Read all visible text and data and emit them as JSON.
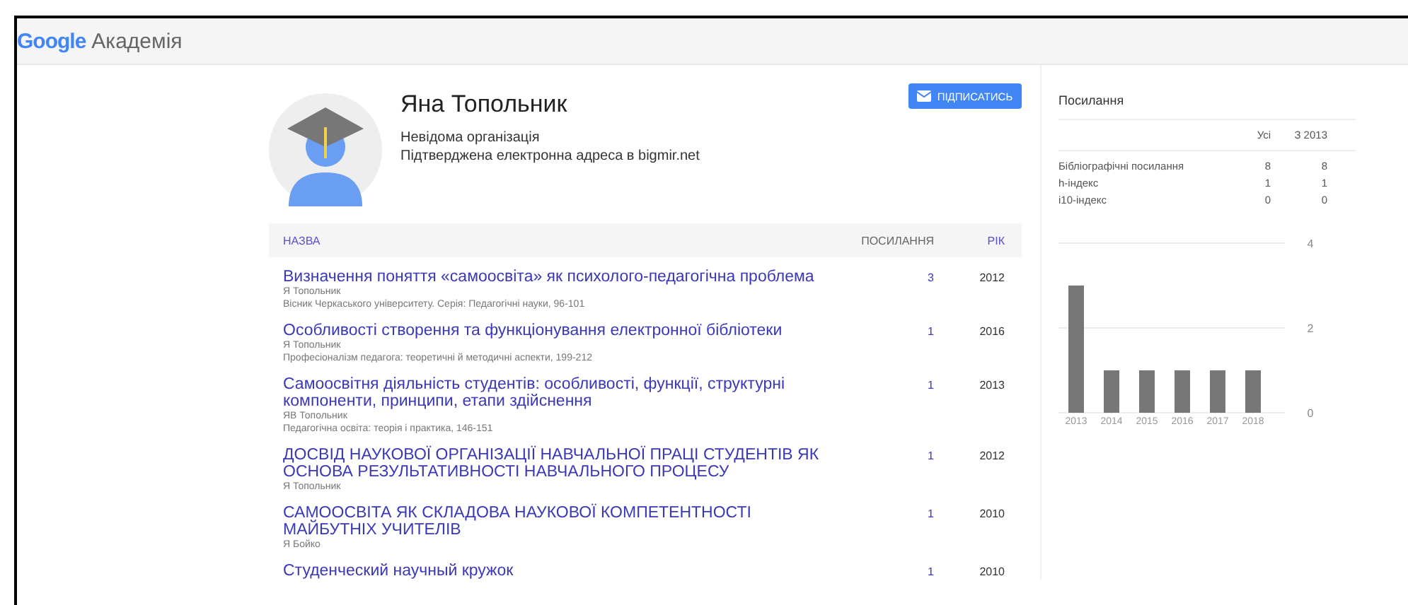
{
  "header": {
    "logo": "Google",
    "product": "Академія"
  },
  "profile": {
    "name": "Яна Топольник",
    "affiliation": "Невідома організація",
    "email": "Підтверджена електронна адреса в bigmir.net",
    "follow_button": "ПІДПИСАТИСЬ"
  },
  "table": {
    "columns": [
      "НАЗВА",
      "ПОСИЛАННЯ",
      "РІК"
    ],
    "rows": [
      {
        "title": "Визначення поняття «самоосвіта» як психолого-педагогічна проблема",
        "authors": "Я Топольник",
        "source": "Вісник Черкаського університету. Серія: Педагогічні науки, 96-101",
        "citations": "3",
        "year": "2012"
      },
      {
        "title": "Особливості створення та функціонування електронної бібліотеки",
        "authors": "Я Топольник",
        "source": "Професіоналізм педагога: теоретичні й методичні аспекти, 199-212",
        "citations": "1",
        "year": "2016"
      },
      {
        "title": "Самоосвітня діяльність студентів: особливості, функції, структурні компоненти, принципи, етапи здійснення",
        "authors": "ЯВ Топольник",
        "source": "Педагогічна освіта: теорія і практика, 146-151",
        "citations": "1",
        "year": "2013"
      },
      {
        "title": "ДОСВІД НАУКОВОЇ ОРГАНІЗАЦІЇ НАВЧАЛЬНОЇ ПРАЦІ СТУДЕНТІВ ЯК ОСНОВА РЕЗУЛЬТАТИВНОСТІ НАВЧАЛЬНОГО ПРОЦЕСУ",
        "authors": "Я Топольник",
        "citations": "1",
        "year": "2012"
      },
      {
        "title": "САМООСВІТА ЯК СКЛАДОВА НАУКОВОЇ КОМПЕТЕНТНОСТІ МАЙБУТНІХ УЧИТЕЛІВ",
        "authors": "Я Бойко",
        "citations": "1",
        "year": "2010"
      },
      {
        "title": "Студенческий научный кружок",
        "citations": "1",
        "year": "2010"
      }
    ]
  },
  "citations_panel": {
    "title": "Посилання",
    "columns": [
      "Усі",
      "З 2013"
    ],
    "rows": [
      {
        "label": "Бібліографічні посилання",
        "all": "8",
        "since": "8"
      },
      {
        "label": "h-індекс",
        "all": "1",
        "since": "1"
      },
      {
        "label": "i10-індекс",
        "all": "0",
        "since": "0"
      }
    ],
    "chart_data": {
      "type": "bar",
      "categories": [
        "2013",
        "2014",
        "2015",
        "2016",
        "2017",
        "2018"
      ],
      "values": [
        3,
        1,
        1,
        1,
        1,
        1
      ],
      "ylim": [
        0,
        4
      ],
      "yticks": [
        0,
        2,
        4
      ]
    }
  }
}
